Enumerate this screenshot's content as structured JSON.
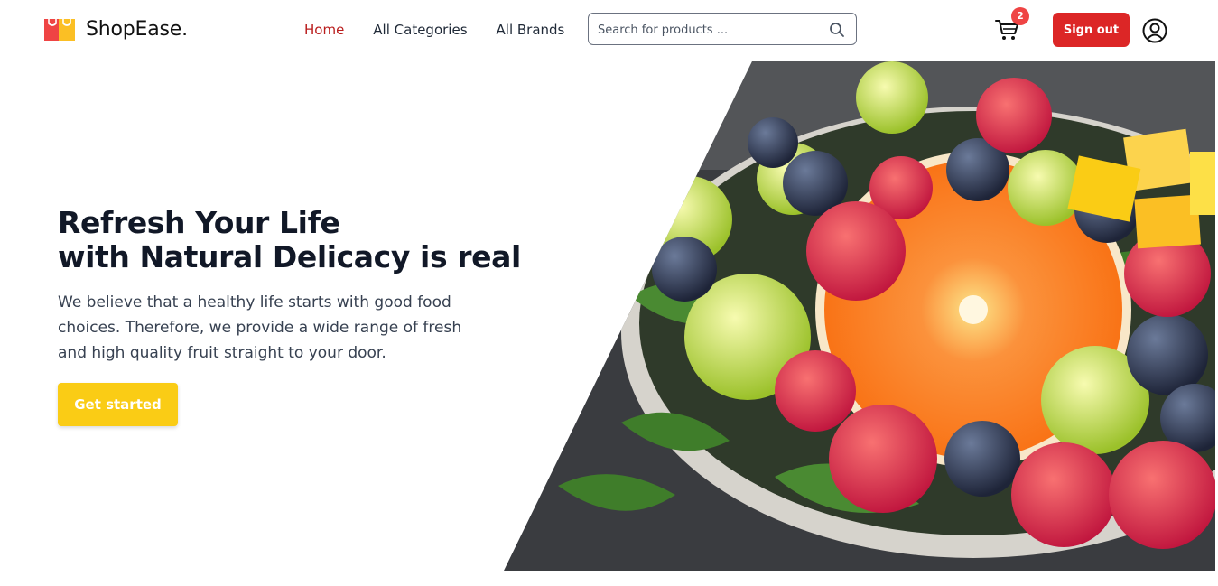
{
  "brand": {
    "name": "ShopEase."
  },
  "nav": {
    "links": [
      {
        "label": "Home",
        "active": true
      },
      {
        "label": "All Categories"
      },
      {
        "label": "All Brands"
      }
    ]
  },
  "search": {
    "placeholder": "Search for products ..."
  },
  "cart": {
    "count": "2"
  },
  "auth": {
    "signout_label": "Sign out"
  },
  "hero": {
    "title_line1": "Refresh Your Life",
    "title_line2": "with Natural Delicacy is real",
    "description": "We believe that a healthy life starts with good food choices. Therefore, we provide a wide range of fresh and high quality fruit straight to your door.",
    "cta_label": "Get started"
  },
  "colors": {
    "accent": "#dc2626",
    "active_link": "#b91c1c",
    "cta": "#facc15",
    "badge": "#ef4444"
  },
  "icons": [
    "shopping-bag-icon",
    "search-icon",
    "cart-icon",
    "user-icon"
  ]
}
